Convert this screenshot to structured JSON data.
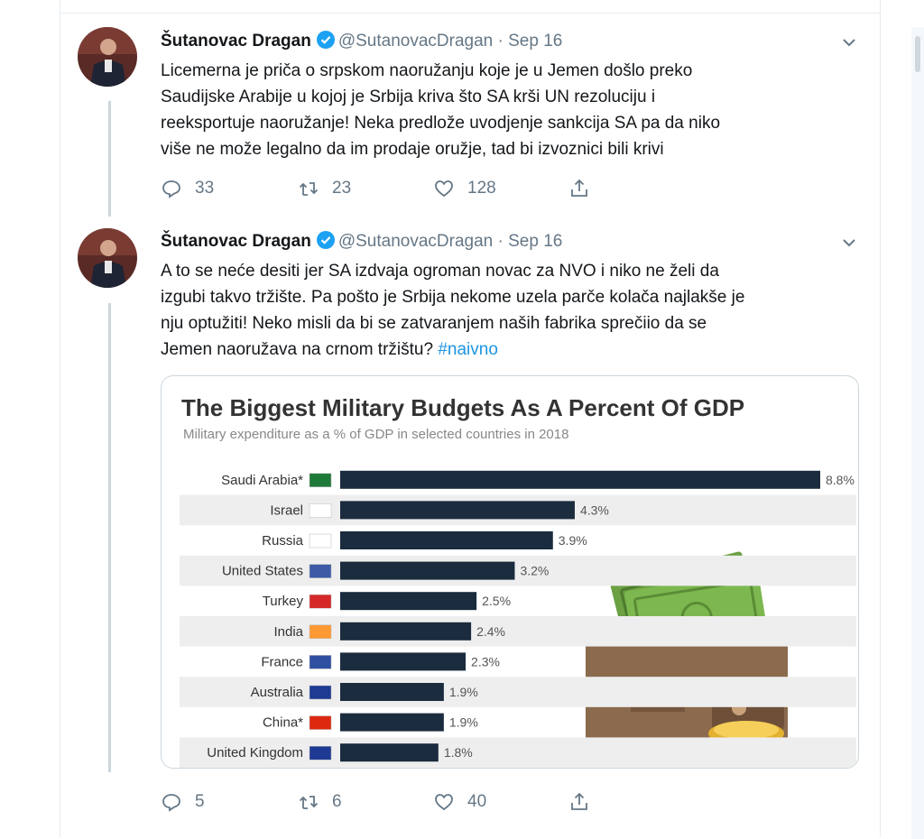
{
  "tweets": [
    {
      "name": "Šutanovac Dragan",
      "handle": "@SutanovacDragan",
      "dot": "·",
      "date": "Sep 16",
      "text": "Licemerna je priča o srpskom naoružanju koje je u Jemen došlo preko Saudijske Arabije u kojoj je Srbija kriva što SA krši UN rezoluciju i reeksportuje naoružanje! Neka predlože uvodjenje sankcija SA pa da niko više ne može legalno da im prodaje oružje, tad bi izvoznici bili krivi",
      "lines": [
        "Licemerna je priča o srpskom naoružanju koje je u Jemen došlo preko",
        "Saudijske Arabije u kojoj je Srbija kriva što SA krši UN rezoluciju i",
        "reeksportuje naoružanje! Neka predlože uvodjenje sankcija SA pa da niko",
        "više ne može legalno da im prodaje oružje, tad bi izvoznici bili krivi"
      ],
      "replies": "33",
      "retweets": "23",
      "likes": "128"
    },
    {
      "name": "Šutanovac Dragan",
      "handle": "@SutanovacDragan",
      "dot": "·",
      "date": "Sep 16",
      "lines": [
        "A to se neće desiti jer SA izdvaja ogroman novac za NVO i niko ne želi da",
        "izgubi takvo tržište. Pa pošto je Srbija nekome uzela parče kolača najlakše je",
        "nju optužiti! Neko misli da bi se zatvaranjem naših fabrika sprečiio da se",
        "Jemen naoružava na crnom tržištu?"
      ],
      "hashtag": "#naivno",
      "replies": "5",
      "retweets": "6",
      "likes": "40"
    }
  ],
  "icons": {
    "verified": "verified-badge-icon",
    "caret": "chevron-down-icon",
    "reply": "reply-icon",
    "retweet": "retweet-icon",
    "like": "heart-icon",
    "share": "share-icon"
  },
  "colors": {
    "bar": "#1a2c3d",
    "row_alt": "#eeeeee",
    "verified": "#1da1f2",
    "hashtag": "#1b95e0",
    "meta": "#657786"
  },
  "chart_data": {
    "type": "bar",
    "orientation": "horizontal",
    "title": "The Biggest Military Budgets As A Percent Of GDP",
    "subtitle": "Military expenditure as a % of GDP in selected countries in 2018",
    "categories": [
      "Saudi Arabia*",
      "Israel",
      "Russia",
      "United States",
      "Turkey",
      "India",
      "France",
      "Australia",
      "China*",
      "United Kingdom"
    ],
    "values": [
      8.8,
      4.3,
      3.9,
      3.2,
      2.5,
      2.4,
      2.3,
      1.9,
      1.9,
      1.8
    ],
    "value_labels": [
      "8.8%",
      "4.3%",
      "3.9%",
      "3.2%",
      "2.5%",
      "2.4%",
      "2.3%",
      "1.9%",
      "1.9%",
      "1.8%"
    ],
    "xlim": [
      0,
      8.8
    ],
    "xlabel": "",
    "ylabel": "",
    "grid": false,
    "legend": "none"
  }
}
